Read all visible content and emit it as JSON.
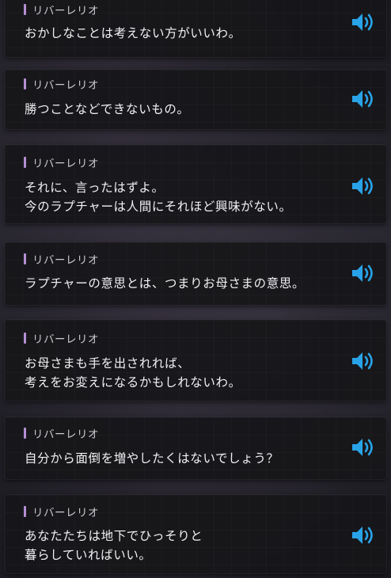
{
  "accent_color": "#29a3e8",
  "speaker_mark_color": "#b58fd6",
  "voice_icon": "speaker-volume-icon",
  "entries": [
    {
      "speaker": "リバーレリオ",
      "lines": [
        "おかしなことは考えない方がいいわ。"
      ]
    },
    {
      "speaker": "リバーレリオ",
      "lines": [
        "勝つことなどできないもの。"
      ]
    },
    {
      "speaker": "リバーレリオ",
      "lines": [
        "それに、言ったはずよ。",
        "今のラプチャーは人間にそれほど興味がない。"
      ]
    },
    {
      "speaker": "リバーレリオ",
      "lines": [
        "ラプチャーの意思とは、つまりお母さまの意思。"
      ]
    },
    {
      "speaker": "リバーレリオ",
      "lines": [
        "お母さまも手を出されれば、",
        "考えをお変えになるかもしれないわ。"
      ]
    },
    {
      "speaker": "リバーレリオ",
      "lines": [
        "自分から面倒を増やしたくはないでしょう？"
      ]
    },
    {
      "speaker": "リバーレリオ",
      "lines": [
        "あなたたちは地下でひっそりと",
        "暮らしていればいい。"
      ]
    }
  ]
}
